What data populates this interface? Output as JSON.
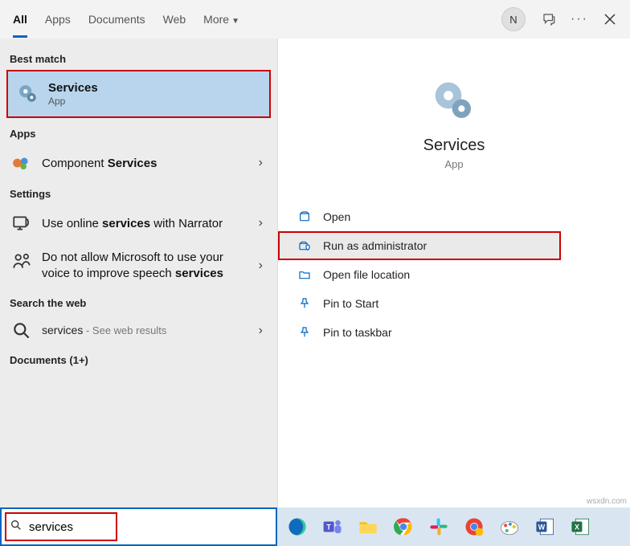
{
  "tabs": {
    "all": "All",
    "apps": "Apps",
    "documents": "Documents",
    "web": "Web",
    "more": "More"
  },
  "avatar_initial": "N",
  "sections": {
    "best": "Best match",
    "apps": "Apps",
    "settings": "Settings",
    "web": "Search the web",
    "docs": "Documents (1+)"
  },
  "best": {
    "title": "Services",
    "sub": "App"
  },
  "app_result": {
    "pre": "Component ",
    "bold": "Services"
  },
  "settings_results": {
    "narrator": {
      "pre": "Use online ",
      "bold": "services",
      "post": " with Narrator"
    },
    "speech": {
      "pre": "Do not allow Microsoft to use your voice to improve speech ",
      "bold": "services"
    }
  },
  "web_result": {
    "term": "services",
    "hint": " - See web results"
  },
  "detail": {
    "title": "Services",
    "sub": "App"
  },
  "actions": {
    "open": "Open",
    "runadmin": "Run as administrator",
    "filelocation": "Open file location",
    "pinstart": "Pin to Start",
    "pintaskbar": "Pin to taskbar"
  },
  "search_value": "services",
  "watermark": "wsxdn.com"
}
